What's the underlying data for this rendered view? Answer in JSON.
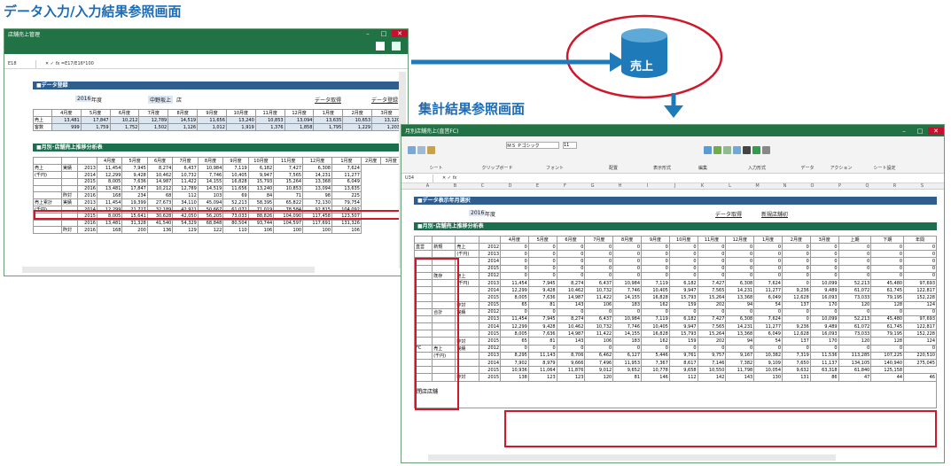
{
  "labels": {
    "left": "データ入力/入力結果参照画面",
    "right": "集計結果参照画面"
  },
  "db": {
    "label": "売上"
  },
  "win1": {
    "title": "店舗売上管理",
    "cellref": "E18",
    "formula": "=E17/E16*100",
    "sec1": "■データ登録",
    "year": "2016",
    "year_unit": "年度",
    "shop": "中野坂上",
    "shop_unit": "店",
    "btn_fetch": "データ取得",
    "btn_reg": "データ登録",
    "months": [
      "4月度",
      "5月度",
      "6月度",
      "7月度",
      "8月度",
      "9月度",
      "10月度",
      "11月度",
      "12月度",
      "1月度",
      "2月度",
      "3月度"
    ],
    "r1": {
      "label": "売上",
      "vals": [
        "13,481",
        "17,847",
        "10,212",
        "12,789",
        "14,519",
        "11,656",
        "13,240",
        "10,853",
        "13,094",
        "13,635",
        "10,653",
        "13,120"
      ]
    },
    "r2": {
      "label": "客数",
      "vals": [
        "999",
        "1,759",
        "1,752",
        "1,502",
        "1,126",
        "1,012",
        "1,919",
        "1,376",
        "1,858",
        "1,795",
        "1,229",
        "1,203"
      ]
    },
    "sec2": "■月別･店舗売上推移分析表",
    "t2_head": [
      "4月度",
      "5月度",
      "6月度",
      "7月度",
      "8月度",
      "9月度",
      "10月度",
      "11月度",
      "12月度",
      "1月度",
      "2月度",
      "3月度"
    ],
    "t2": [
      [
        "売上",
        "実績",
        "2013",
        "11,454",
        "7,945",
        "8,274",
        "6,437",
        "10,984",
        "7,119",
        "6,182",
        "7,427",
        "6,308",
        "7,624"
      ],
      [
        "(千円)",
        "",
        "2014",
        "12,299",
        "9,428",
        "10,462",
        "10,732",
        "7,746",
        "10,405",
        "9,947",
        "7,565",
        "14,231",
        "11,277"
      ],
      [
        "",
        "",
        "2015",
        "8,005",
        "7,636",
        "14,987",
        "11,422",
        "14,155",
        "16,828",
        "15,793",
        "15,264",
        "13,368",
        "6,049"
      ],
      [
        "",
        "",
        "2016",
        "13,481",
        "17,847",
        "10,212",
        "12,789",
        "14,519",
        "11,656",
        "13,240",
        "10,853",
        "13,094",
        "13,635"
      ],
      [
        "",
        "昨対",
        "2016",
        "168",
        "234",
        "68",
        "112",
        "103",
        "69",
        "84",
        "71",
        "98",
        "225"
      ],
      [
        "売上累計",
        "実績",
        "2013",
        "11,454",
        "19,399",
        "27,673",
        "34,110",
        "45,094",
        "52,213",
        "58,395",
        "65,822",
        "72,130",
        "79,754"
      ],
      [
        "(千円)",
        "",
        "2014",
        "12,299",
        "21,727",
        "32,189",
        "42,921",
        "50,667",
        "61,072",
        "71,019",
        "78,584",
        "92,815",
        "104,092"
      ],
      [
        "",
        "",
        "2015",
        "8,005",
        "15,641",
        "30,628",
        "42,050",
        "56,205",
        "73,033",
        "88,826",
        "104,090",
        "117,458",
        "123,507"
      ],
      [
        "",
        "",
        "2016",
        "13,481",
        "31,328",
        "41,540",
        "54,329",
        "68,848",
        "80,504",
        "93,744",
        "104,597",
        "117,691",
        "131,326"
      ],
      [
        "",
        "昨対",
        "2016",
        "168",
        "200",
        "136",
        "129",
        "122",
        "110",
        "106",
        "100",
        "100",
        "106"
      ]
    ]
  },
  "win2": {
    "title": "月別店舗売上(直営FC)",
    "font": "ＭＳ Ｐゴシック",
    "size": "11",
    "ribbon": [
      "シート",
      "クリップボード",
      "フォント",
      "配置",
      "表示形式",
      "編集",
      "入力形式",
      "データ",
      "アクション",
      "シート設定"
    ],
    "cellref": "U34",
    "cols": [
      "A",
      "B",
      "C",
      "D",
      "E",
      "F",
      "G",
      "H",
      "I",
      "J",
      "K",
      "L",
      "M",
      "N",
      "O",
      "P",
      "Q",
      "R",
      "S"
    ],
    "sec1": "■データ表示年月選択",
    "year": "2016",
    "year_unit": "年度",
    "btn_fetch": "データ取得",
    "btn_new": "新規店舗初",
    "sec2": "■月別･店舗売上推移分析表",
    "head": [
      "4月度",
      "5月度",
      "6月度",
      "7月度",
      "8月度",
      "9月度",
      "10月度",
      "11月度",
      "12月度",
      "1月度",
      "2月度",
      "3月度",
      "上期",
      "下期",
      "年間"
    ],
    "rows": [
      [
        "直営",
        "新規",
        "売上",
        "2012",
        "0",
        "0",
        "0",
        "0",
        "0",
        "0",
        "0",
        "0",
        "0",
        "0",
        "0",
        "0",
        "0",
        "0",
        "0"
      ],
      [
        "",
        "",
        "(千円)",
        "2013",
        "0",
        "0",
        "0",
        "0",
        "0",
        "0",
        "0",
        "0",
        "0",
        "0",
        "0",
        "0",
        "0",
        "0",
        "0"
      ],
      [
        "",
        "",
        "",
        "2014",
        "0",
        "0",
        "0",
        "0",
        "0",
        "0",
        "0",
        "0",
        "0",
        "0",
        "0",
        "0",
        "0",
        "0",
        "0"
      ],
      [
        "",
        "",
        "",
        "2015",
        "0",
        "0",
        "0",
        "0",
        "0",
        "0",
        "0",
        "0",
        "0",
        "0",
        "0",
        "0",
        "0",
        "0",
        "0"
      ],
      [
        "",
        "既存",
        "売上",
        "2012",
        "0",
        "0",
        "0",
        "0",
        "0",
        "0",
        "0",
        "0",
        "0",
        "0",
        "0",
        "0",
        "0",
        "0",
        "0"
      ],
      [
        "",
        "",
        "(千円)",
        "2013",
        "11,454",
        "7,945",
        "8,274",
        "6,437",
        "10,984",
        "7,119",
        "6,182",
        "7,427",
        "6,308",
        "7,624",
        "0",
        "10,099",
        "52,213",
        "45,480",
        "97,693"
      ],
      [
        "",
        "",
        "",
        "2014",
        "12,299",
        "9,428",
        "10,462",
        "10,732",
        "7,746",
        "10,405",
        "9,947",
        "7,565",
        "14,231",
        "11,277",
        "9,236",
        "9,489",
        "61,072",
        "61,745",
        "122,817"
      ],
      [
        "",
        "",
        "",
        "2015",
        "8,005",
        "7,636",
        "14,987",
        "11,422",
        "14,155",
        "16,828",
        "15,793",
        "15,264",
        "13,368",
        "6,049",
        "12,628",
        "16,093",
        "73,033",
        "79,195",
        "152,228"
      ],
      [
        "",
        "",
        "昨対",
        "2015",
        "65",
        "81",
        "143",
        "106",
        "183",
        "162",
        "159",
        "202",
        "94",
        "54",
        "137",
        "170",
        "120",
        "128",
        "124"
      ],
      [
        "",
        "合計",
        "実績",
        "2012",
        "0",
        "0",
        "0",
        "0",
        "0",
        "0",
        "0",
        "0",
        "0",
        "0",
        "0",
        "0",
        "0",
        "0",
        "0"
      ],
      [
        "",
        "",
        "",
        "2013",
        "11,454",
        "7,945",
        "8,274",
        "6,437",
        "10,984",
        "7,119",
        "6,182",
        "7,427",
        "6,308",
        "7,624",
        "0",
        "10,099",
        "52,213",
        "45,480",
        "97,693"
      ],
      [
        "",
        "",
        "",
        "2014",
        "12,299",
        "9,428",
        "10,462",
        "10,732",
        "7,746",
        "10,405",
        "9,947",
        "7,565",
        "14,231",
        "11,277",
        "9,236",
        "9,489",
        "61,072",
        "61,745",
        "122,817"
      ],
      [
        "",
        "",
        "",
        "2015",
        "8,005",
        "7,636",
        "14,987",
        "11,422",
        "14,155",
        "16,828",
        "15,793",
        "15,264",
        "13,368",
        "6,049",
        "12,628",
        "16,093",
        "73,033",
        "79,195",
        "152,228"
      ],
      [
        "",
        "",
        "昨対",
        "2015",
        "65",
        "81",
        "143",
        "106",
        "183",
        "162",
        "159",
        "202",
        "94",
        "54",
        "137",
        "170",
        "120",
        "128",
        "124"
      ],
      [
        "FC",
        "売上",
        "実績",
        "2012",
        "0",
        "0",
        "0",
        "0",
        "0",
        "0",
        "0",
        "0",
        "0",
        "0",
        "0",
        "0",
        "0",
        "0",
        "0"
      ],
      [
        "",
        "(千円)",
        "",
        "2013",
        "8,295",
        "11,143",
        "8,706",
        "6,462",
        "6,127",
        "5,446",
        "9,761",
        "9,757",
        "9,167",
        "10,382",
        "7,319",
        "11,536",
        "113,285",
        "107,225",
        "220,510"
      ],
      [
        "",
        "",
        "",
        "2014",
        "7,902",
        "8,979",
        "9,666",
        "7,496",
        "11,953",
        "7,367",
        "8,617",
        "7,146",
        "7,382",
        "9,109",
        "7,650",
        "11,137",
        "134,105",
        "140,940",
        "275,045"
      ],
      [
        "",
        "",
        "",
        "2015",
        "10,936",
        "11,064",
        "11,876",
        "9,012",
        "9,652",
        "10,778",
        "9,658",
        "10,550",
        "11,798",
        "10,054",
        "9,632",
        "63,318",
        "61,840",
        "125,158"
      ],
      [
        "",
        "",
        "昨対",
        "2015",
        "138",
        "123",
        "123",
        "120",
        "81",
        "146",
        "112",
        "142",
        "143",
        "130",
        "131",
        "86",
        "47",
        "44",
        "46"
      ]
    ],
    "closed": "閉店店舗"
  }
}
